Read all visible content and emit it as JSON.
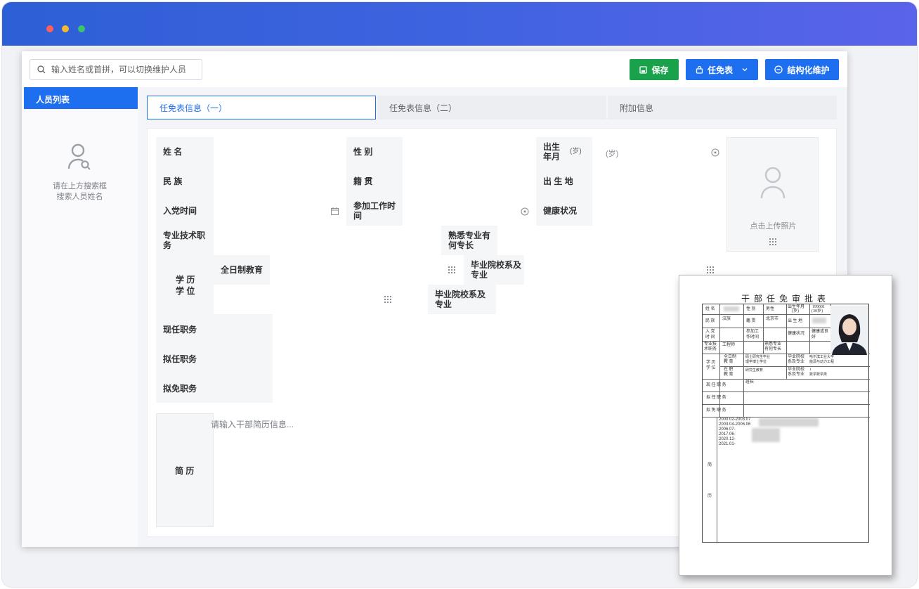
{
  "window": {
    "traffic_lights": [
      "#ff5f57",
      "#f5b82e",
      "#3cc46b"
    ],
    "titlebar_gradient": [
      "#2d5fd6",
      "#5a63ea"
    ]
  },
  "search": {
    "placeholder": "输入姓名或首拼，可以切换维护人员",
    "value": ""
  },
  "toolbar": {
    "save_label": "保存",
    "appoint_label": "任免表",
    "struct_label": "结构化维护"
  },
  "sidebar": {
    "title": "人员列表",
    "empty_line1": "请在上方搜索框",
    "empty_line2": "搜索人员姓名"
  },
  "tabs": [
    {
      "label": "任免表信息（一）",
      "active": true
    },
    {
      "label": "任免表信息（二）",
      "active": false
    },
    {
      "label": "附加信息",
      "active": false
    }
  ],
  "form": {
    "name": "姓 名",
    "gender": "性 别",
    "birth_l1": "出生",
    "birth_l2": "年月",
    "age_unit": "(岁)",
    "age_value": "(岁)",
    "ethnicity": "民 族",
    "native_place": "籍 贯",
    "birthplace": "出 生 地",
    "party_join": "入党时间",
    "work_start_l1": "参加工作时",
    "work_start_l2": "间",
    "health": "健康状况",
    "tech_title_l1": "专业技术职",
    "tech_title_l2": "务",
    "expertise_l1": "熟悉专业有",
    "expertise_l2": "何专长",
    "education_l1": "学 历",
    "education_l2": "学 位",
    "fulltime_edu": "全日制教育",
    "grad_school_1_l1": "毕业院校系及",
    "grad_school_1_l2": "专业",
    "grad_school_2_l1": "毕业院校系及",
    "grad_school_2_l2": "专业",
    "current_post": "现任职务",
    "proposed_post": "拟任职务",
    "proposed_removal": "拟免职务",
    "resume": "简 历",
    "resume_placeholder": "请输入干部简历信息...",
    "photo_upload": "点击上传照片"
  },
  "document": {
    "title": "干部任免审批表",
    "name_l": "姓 名",
    "gender_l": "性 别",
    "gender_v": "男性",
    "birth_l1": "出生年月",
    "birth_l2": "(岁)",
    "birth_v1": "199001",
    "birth_v2": "(30岁)",
    "ethnicity_l": "民 族",
    "ethnicity_v": "汉族",
    "native_l": "籍 贯",
    "native_v": "北京市",
    "birthplace_l": "出 生 地",
    "party_l1": "入 党",
    "party_l2": "时 间",
    "work_l1": "参加工",
    "work_l2": "作时间",
    "health_l": "健康状况",
    "health_v1": "健康或良",
    "health_v2": "好",
    "tech_l1": "专业技",
    "tech_l2": "术职务",
    "tech_v": "工程师",
    "expert_l1": "熟悉专业",
    "expert_l2": "有何专长",
    "edu_l1": "学 历",
    "edu_l2": "学 位",
    "fulltime_l1": "全日制",
    "fulltime_l2": "教 育",
    "fulltime_v1": "硕士研究生毕业",
    "fulltime_v2": "理学博士学位",
    "grad1_l1": "毕业院校",
    "grad1_l2": "系及专业",
    "grad1_v1": "哈尔滨工业大学",
    "grad1_v2": "能源与动力工程",
    "inservice_l1": "在 职",
    "inservice_l2": "教 育",
    "inservice_v": "研究生教育",
    "grad2_l1": "毕业院校",
    "grad2_l2": "系及专业",
    "grad2_v1": "1",
    "grad2_v2": "数学数学类",
    "current_l": "现 任 职 务",
    "current_v": "班长",
    "proposed_l": "拟 任 职 务",
    "removal_l": "拟 免 职 务",
    "resume_l1": "简",
    "resume_l2": "历",
    "resume_lines": [
      "2000.02-2003.07",
      "2003.04-2006.06",
      "2006.07-",
      "2017.06-",
      "2020.12-",
      "2021.01-"
    ]
  },
  "colors": {
    "primary": "#1e6ff0",
    "save_green": "#1aa14b"
  }
}
